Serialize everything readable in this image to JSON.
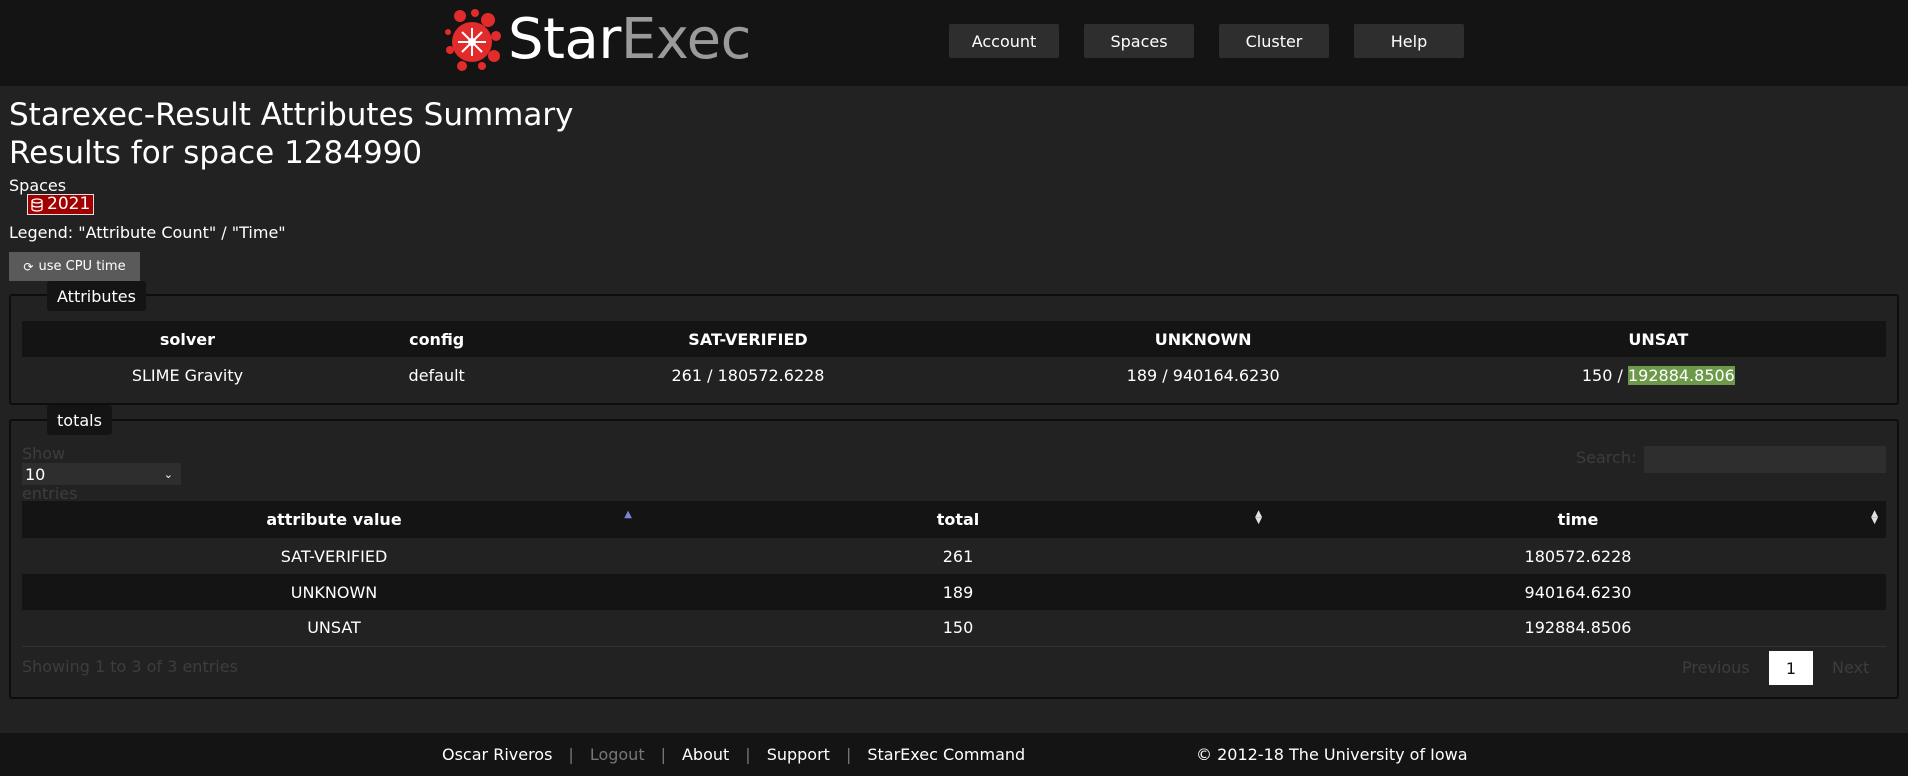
{
  "header": {
    "logo_star": "Star",
    "logo_exec": "Exec",
    "nav": [
      "Account",
      "Spaces",
      "Cluster",
      "Help"
    ]
  },
  "page": {
    "title": "Starexec-Result Attributes Summary",
    "subtitle": "Results for space 1284990",
    "spaces_label": "Spaces",
    "space_badge": "2021",
    "legend": "Legend: \"Attribute Count\" / \"Time\"",
    "cpu_button": "use CPU time",
    "icons": {
      "space": "database-icon",
      "cpu": "refresh-icon"
    }
  },
  "attributes": {
    "legend": "Attributes",
    "columns": [
      "solver",
      "config",
      "SAT-VERIFIED",
      "UNKNOWN",
      "UNSAT"
    ],
    "row": {
      "solver": "SLIME Gravity",
      "config": "default",
      "sat_verified": "261 / 180572.6228",
      "unknown": "189 / 940164.6230",
      "unsat_count": "150 / ",
      "unsat_time": "192884.8506"
    },
    "highlight_color": "#6d9a4a"
  },
  "totals": {
    "legend": "totals",
    "show_label": "Show",
    "entries_label": "entries",
    "page_length": "10",
    "search_label": "Search:",
    "search_value": "",
    "columns": [
      "attribute value",
      "total",
      "time"
    ],
    "rows": [
      [
        "SAT-VERIFIED",
        "261",
        "180572.6228"
      ],
      [
        "UNKNOWN",
        "189",
        "940164.6230"
      ],
      [
        "UNSAT",
        "150",
        "192884.8506"
      ]
    ],
    "info": "Showing 1 to 3 of 3 entries",
    "pagination": {
      "previous": "Previous",
      "current": "1",
      "next": "Next"
    }
  },
  "footer": {
    "user": "Oscar Riveros",
    "logout": "Logout",
    "about": "About",
    "support": "Support",
    "command": "StarExec Command",
    "copyright": "© 2012-18 The University of Iowa"
  }
}
